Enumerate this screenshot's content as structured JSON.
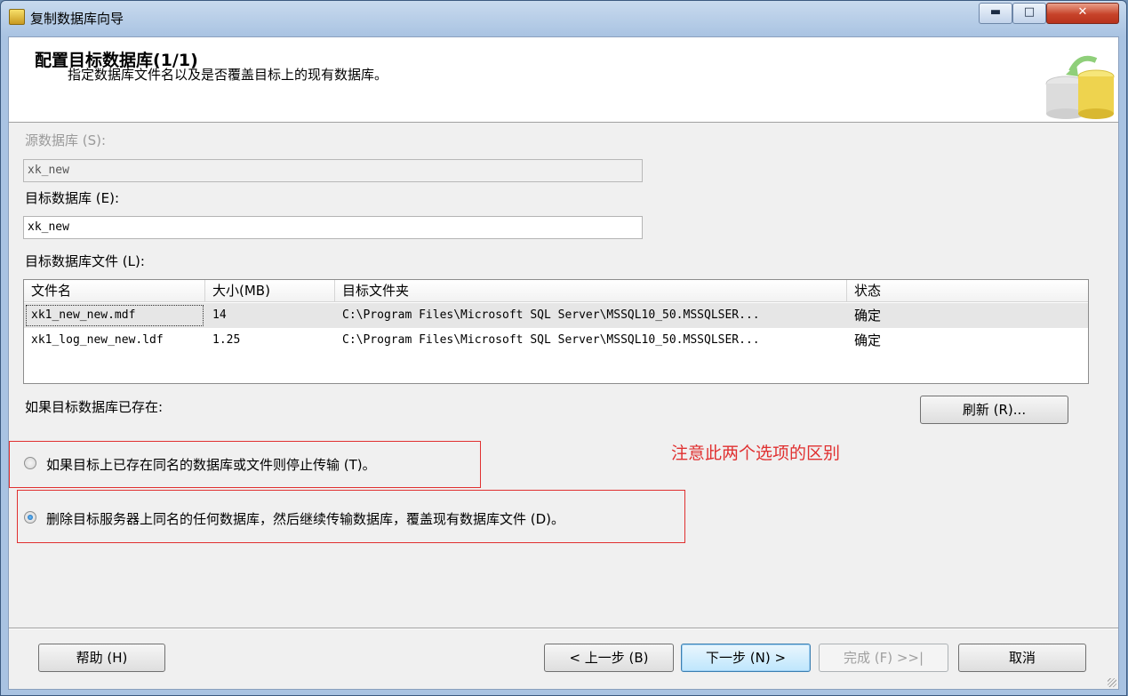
{
  "window": {
    "title": "复制数据库向导",
    "controls": {
      "minimize": "▬",
      "maximize": "□",
      "close": "✕"
    }
  },
  "header": {
    "title": "配置目标数据库(1/1)",
    "subtitle": "指定数据库文件名以及是否覆盖目标上的现有数据库。",
    "graphic_icon": "database-copy-icon"
  },
  "source": {
    "label": "源数据库 (S):",
    "value": "xk_new"
  },
  "target": {
    "label": "目标数据库 (E):",
    "value": "xk_new"
  },
  "files": {
    "label": "目标数据库文件 (L):",
    "columns": [
      "文件名",
      "大小(MB)",
      "目标文件夹",
      "状态"
    ],
    "rows": [
      {
        "name": "xk1_new_new.mdf",
        "size": "14",
        "folder": "C:\\Program Files\\Microsoft SQL Server\\MSSQL10_50.MSSQLSER...",
        "status": "确定"
      },
      {
        "name": "xk1_log_new_new.ldf",
        "size": "1.25",
        "folder": "C:\\Program Files\\Microsoft SQL Server\\MSSQL10_50.MSSQLSER...",
        "status": "确定"
      }
    ]
  },
  "exists": {
    "label": "如果目标数据库已存在:",
    "refresh_button": "刷新 (R)...",
    "option_stop": "如果目标上已存在同名的数据库或文件则停止传输 (T)。",
    "option_drop": "删除目标服务器上同名的任何数据库，然后继续传输数据库，覆盖现有数据库文件 (D)。",
    "selected": "drop"
  },
  "annotation": {
    "note": "注意此两个选项的区别",
    "color": "#e03030"
  },
  "footer": {
    "help": "帮助 (H)",
    "back": "< 上一步 (B)",
    "next": "下一步 (N) >",
    "finish": "完成 (F) >>|",
    "cancel": "取消"
  }
}
